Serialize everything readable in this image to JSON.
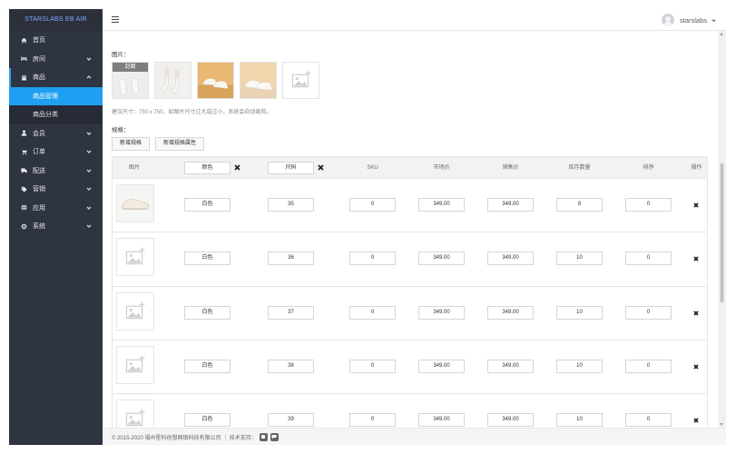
{
  "brand": "STARSLABS EB AIR",
  "sidebar": {
    "items": [
      {
        "label": "首页",
        "icon": "home-icon",
        "has_children": false
      },
      {
        "label": "房间",
        "icon": "bed-icon",
        "has_children": true
      },
      {
        "label": "商品",
        "icon": "gift-icon",
        "has_children": true,
        "open": true,
        "children": [
          {
            "label": "商品管理",
            "active": true
          },
          {
            "label": "商品分类",
            "active": false
          }
        ]
      },
      {
        "label": "会员",
        "icon": "user-icon",
        "has_children": true
      },
      {
        "label": "订单",
        "icon": "cart-icon",
        "has_children": true
      },
      {
        "label": "配送",
        "icon": "truck-icon",
        "has_children": true
      },
      {
        "label": "营销",
        "icon": "tag-icon",
        "has_children": true
      },
      {
        "label": "应用",
        "icon": "globe-icon",
        "has_children": true
      },
      {
        "label": "系统",
        "icon": "gear-icon",
        "has_children": true
      }
    ]
  },
  "topbar": {
    "username": "starslabs"
  },
  "form": {
    "images_label": "图片：",
    "cover_label": "封面",
    "image_hint": "建议尺寸：750 x 750，如图片尺寸过大或过小，系统会自动裁剪。",
    "spec_label": "规格：",
    "add_spec_button": "新增规格",
    "add_spec_attr_button": "新增规格属性"
  },
  "table": {
    "columns": {
      "image": "图片",
      "color": "颜色",
      "size": "尺码",
      "sku": "SKU",
      "market_price": "市场价",
      "sale_price": "销售价",
      "stock": "库存数量",
      "sort": "排序",
      "action": "操作"
    },
    "rows": [
      {
        "has_image": true,
        "color": "白色",
        "size": "35",
        "sku": "0",
        "market_price": "349.00",
        "sale_price": "349.00",
        "stock": "8",
        "sort": "0"
      },
      {
        "has_image": false,
        "color": "白色",
        "size": "36",
        "sku": "0",
        "market_price": "349.00",
        "sale_price": "349.00",
        "stock": "10",
        "sort": "0"
      },
      {
        "has_image": false,
        "color": "白色",
        "size": "37",
        "sku": "0",
        "market_price": "349.00",
        "sale_price": "349.00",
        "stock": "10",
        "sort": "0"
      },
      {
        "has_image": false,
        "color": "白色",
        "size": "38",
        "sku": "0",
        "market_price": "349.00",
        "sale_price": "349.00",
        "stock": "10",
        "sort": "0"
      },
      {
        "has_image": false,
        "color": "白色",
        "size": "39",
        "sku": "0",
        "market_price": "349.00",
        "sale_price": "349.00",
        "stock": "10",
        "sort": "0"
      }
    ]
  },
  "footer": {
    "text": "© 2015-2020 福州星科创想网络科技有限公司 ｜ 技术支持："
  },
  "colors": {
    "sidebar_bg": "#2f3442",
    "active_blue": "#1e9ff2",
    "brand_text": "#7fa7ff"
  }
}
